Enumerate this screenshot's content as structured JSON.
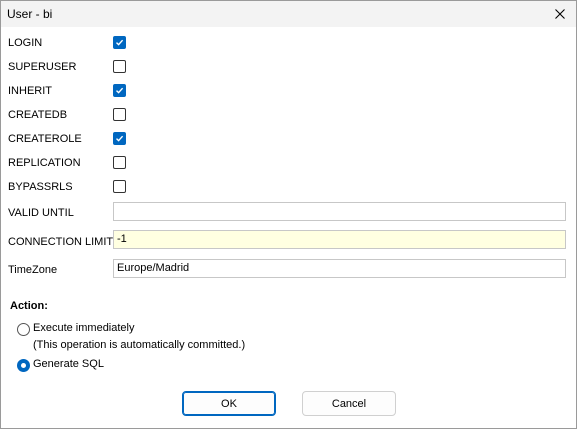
{
  "window": {
    "title": "User - bi"
  },
  "options": [
    {
      "label": "LOGIN",
      "checked": true
    },
    {
      "label": "SUPERUSER",
      "checked": false
    },
    {
      "label": "INHERIT",
      "checked": true
    },
    {
      "label": "CREATEDB",
      "checked": false
    },
    {
      "label": "CREATEROLE",
      "checked": true
    },
    {
      "label": "REPLICATION",
      "checked": false
    },
    {
      "label": "BYPASSRLS",
      "checked": false
    }
  ],
  "fields": {
    "valid_until": {
      "label": "VALID UNTIL",
      "value": ""
    },
    "connection_limit": {
      "label": "CONNECTION LIMIT",
      "value": "-1"
    },
    "timezone": {
      "label": "TimeZone",
      "value": "Europe/Madrid"
    }
  },
  "action": {
    "title": "Action:",
    "execute_label": "Execute immediately",
    "execute_note": "(This operation is automatically committed.)",
    "execute_selected": false,
    "generate_label": "Generate SQL",
    "generate_selected": true
  },
  "buttons": {
    "ok_label": "OK",
    "cancel_label": "Cancel"
  },
  "colors": {
    "accent": "#0067c0",
    "highlight_field": "#ffffe1"
  },
  "icons": {
    "close": "close-icon",
    "check": "checkmark-icon"
  }
}
